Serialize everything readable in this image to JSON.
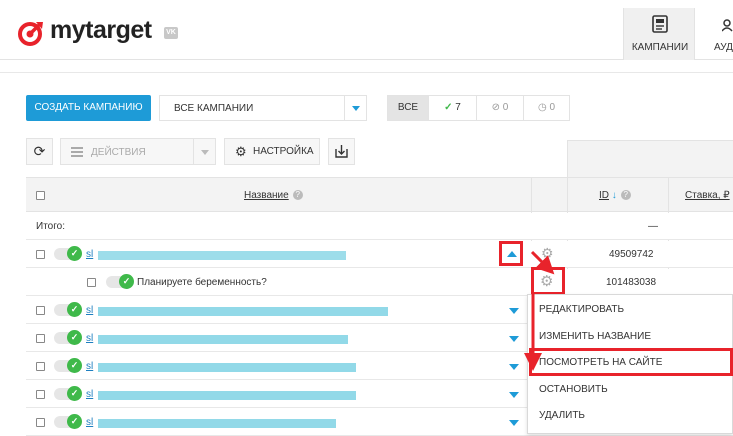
{
  "header": {
    "logo_text": "mytarget",
    "vk_badge": "VK",
    "nav": [
      {
        "label": "КАМПАНИИ",
        "icon": "campaigns-icon",
        "active": true
      },
      {
        "label": "АУД",
        "icon": "audience-icon",
        "active": false
      }
    ]
  },
  "toolbar": {
    "create_label": "СОЗДАТЬ КАМПАНИЮ",
    "campaign_filter": "ВСЕ КАМПАНИИ",
    "status_filters": {
      "all_label": "ВСЕ",
      "active_count": "7",
      "stopped_count": "0",
      "archived_count": "0"
    },
    "actions_placeholder": "ДЕЙСТВИЯ",
    "settings_label": "НАСТРОЙКА"
  },
  "table": {
    "columns": {
      "name": "Название",
      "id": "ID",
      "rate": "Ставка, ₽"
    },
    "total_label": "Итого:",
    "total_id": "—",
    "campaigns": [
      {
        "prefix": "sl",
        "id": "49509742",
        "expanded": true
      },
      {
        "prefix": "sl",
        "id": ""
      },
      {
        "prefix": "sl",
        "id": ""
      },
      {
        "prefix": "sl",
        "id": ""
      },
      {
        "prefix": "sl",
        "id": ""
      },
      {
        "prefix": "sl",
        "id": ""
      }
    ],
    "banner": {
      "label": "Планируете беременность?",
      "id": "101483038"
    }
  },
  "context_menu": {
    "items": [
      "РЕДАКТИРОВАТЬ",
      "ИЗМЕНИТЬ НАЗВАНИЕ",
      "ПОСМОТРЕТЬ НА САЙТЕ",
      "ОСТАНОВИТЬ",
      "УДАЛИТЬ"
    ],
    "highlighted": "ПОСМОТРЕТЬ НА САЙТЕ"
  },
  "colors": {
    "accent": "#1e9bd7",
    "success": "#3fb94a",
    "annotation": "#e8232b",
    "redacted": "#92d9e8"
  }
}
